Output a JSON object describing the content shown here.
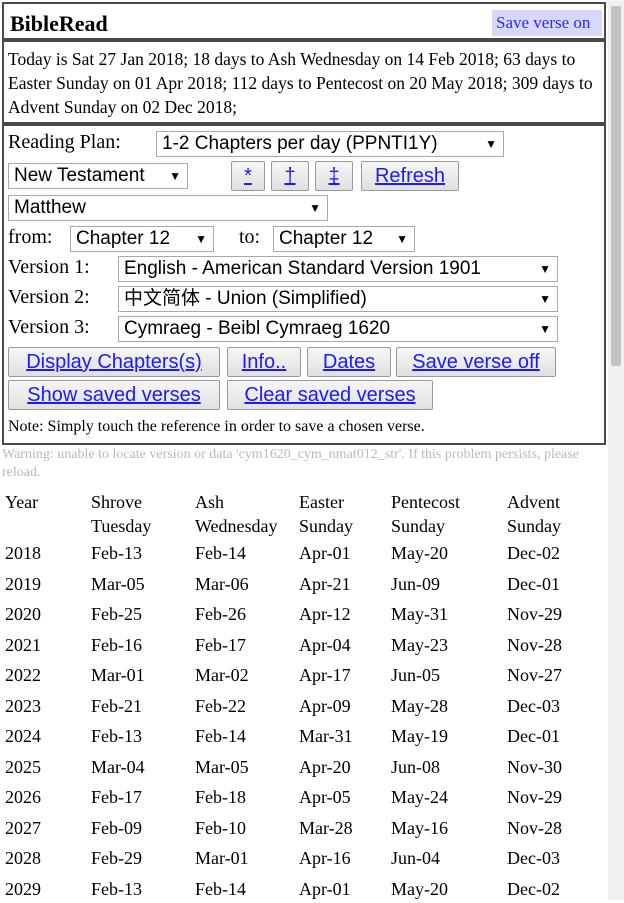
{
  "header": {
    "title": "BibleRead",
    "save_verse_label": "Save verse on"
  },
  "dates_text": "Today is Sat 27 Jan 2018; 18 days to Ash Wednesday on 14 Feb 2018; 63 days to Easter Sunday on 01 Apr 2018; 112 days to Pentecost on 20 May 2018; 309 days to Advent Sunday on 02 Dec 2018;",
  "controls": {
    "reading_plan_label": "Reading Plan:",
    "reading_plan_value": "1-2 Chapters per day (PPNTI1Y)",
    "testament_value": "New Testament",
    "btn_star": "*",
    "btn_dagger": "†",
    "btn_ddagger": "‡",
    "refresh_label": "Refresh",
    "book_value": "Matthew",
    "from_label": "from:",
    "from_value": "Chapter 12",
    "to_label": "to:",
    "to_value": "Chapter 12",
    "version1_label": "Version 1:",
    "version1_value": "English - American Standard Version 1901",
    "version2_label": "Version 2:",
    "version2_value": "中文简体 - Union (Simplified)",
    "version3_label": "Version 3:",
    "version3_value": "Cymraeg - Beibl Cymraeg 1620",
    "display_chapters_label": "Display Chapters(s)",
    "info_label": "Info..",
    "dates_label": "Dates",
    "save_verse_off_label": "Save verse off",
    "show_saved_label": "Show saved verses",
    "clear_saved_label": "Clear saved verses",
    "note": "Note: Simply touch the reference in order to save a chosen verse."
  },
  "warning": "Warning: unable to locate version or data 'cym1620_cym_nmat012_str'. If this problem persists, please reload.",
  "table": {
    "headers": [
      [
        "Year",
        ""
      ],
      [
        "Shrove",
        "Tuesday"
      ],
      [
        "Ash",
        "Wednesday"
      ],
      [
        "Easter",
        "Sunday"
      ],
      [
        "Pentecost",
        "Sunday"
      ],
      [
        "Advent",
        "Sunday"
      ]
    ],
    "rows": [
      [
        "2018",
        "Feb-13",
        "Feb-14",
        "Apr-01",
        "May-20",
        "Dec-02"
      ],
      [
        "2019",
        "Mar-05",
        "Mar-06",
        "Apr-21",
        "Jun-09",
        "Dec-01"
      ],
      [
        "2020",
        "Feb-25",
        "Feb-26",
        "Apr-12",
        "May-31",
        "Nov-29"
      ],
      [
        "2021",
        "Feb-16",
        "Feb-17",
        "Apr-04",
        "May-23",
        "Nov-28"
      ],
      [
        "2022",
        "Mar-01",
        "Mar-02",
        "Apr-17",
        "Jun-05",
        "Nov-27"
      ],
      [
        "2023",
        "Feb-21",
        "Feb-22",
        "Apr-09",
        "May-28",
        "Dec-03"
      ],
      [
        "2024",
        "Feb-13",
        "Feb-14",
        "Mar-31",
        "May-19",
        "Dec-01"
      ],
      [
        "2025",
        "Mar-04",
        "Mar-05",
        "Apr-20",
        "Jun-08",
        "Nov-30"
      ],
      [
        "2026",
        "Feb-17",
        "Feb-18",
        "Apr-05",
        "May-24",
        "Nov-29"
      ],
      [
        "2027",
        "Feb-09",
        "Feb-10",
        "Mar-28",
        "May-16",
        "Nov-28"
      ],
      [
        "2028",
        "Feb-29",
        "Mar-01",
        "Apr-16",
        "Jun-04",
        "Dec-03"
      ],
      [
        "2029",
        "Feb-13",
        "Feb-14",
        "Apr-01",
        "May-20",
        "Dec-02"
      ]
    ]
  }
}
